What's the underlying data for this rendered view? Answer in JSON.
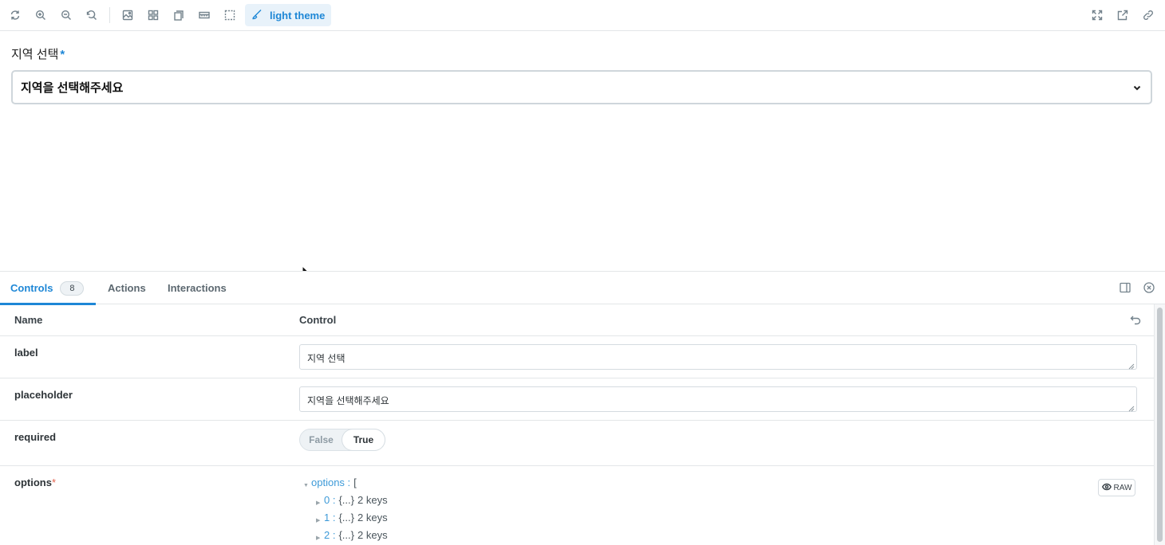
{
  "toolbar": {
    "left_icons": [
      "reload-icon",
      "zoom-in-icon",
      "zoom-out-icon",
      "reset-zoom-icon",
      "background-icon",
      "grid-icon",
      "viewport-icon",
      "measure-icon",
      "outline-icon"
    ],
    "theme_label": "light theme",
    "right_icons": [
      "fullscreen-icon",
      "open-new-tab-icon",
      "copy-link-icon"
    ],
    "accent": "#1e87d6"
  },
  "preview": {
    "label": "지역 선택",
    "required_mark": "*",
    "select_value": "지역을 선택해주세요"
  },
  "panel": {
    "tabs": [
      {
        "label": "Controls",
        "badge": "8",
        "active": true
      },
      {
        "label": "Actions"
      },
      {
        "label": "Interactions"
      }
    ],
    "table": {
      "col_name": "Name",
      "col_control": "Control"
    },
    "rows": {
      "label": {
        "name": "label",
        "value": "지역 선택"
      },
      "placeholder": {
        "name": "placeholder",
        "value": "지역을 선택해주세요"
      },
      "required": {
        "name": "required",
        "false_label": "False",
        "true_label": "True",
        "selected": "True"
      },
      "options": {
        "name": "options",
        "star": "*",
        "root_key": "options :",
        "root_brace": "[",
        "items": [
          {
            "key": "0 :",
            "brace": "{...}",
            "meta": "2 keys"
          },
          {
            "key": "1 :",
            "brace": "{...}",
            "meta": "2 keys"
          },
          {
            "key": "2 :",
            "brace": "{...}",
            "meta": "2 keys"
          }
        ],
        "raw_label": "RAW"
      }
    }
  }
}
